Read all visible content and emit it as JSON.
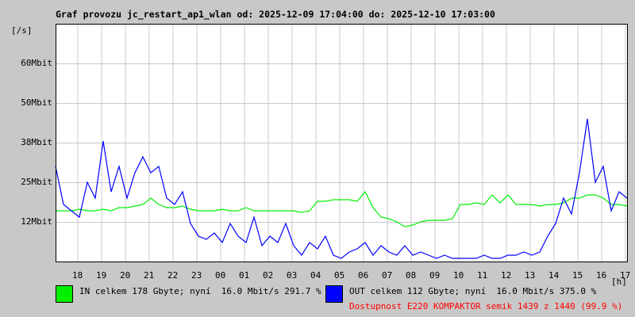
{
  "chart_data": {
    "type": "line",
    "title": "Graf provozu jc_restart_ap1_wlan od: 2025-12-09 17:04:00 do: 2025-12-10 17:03:00",
    "ylabel": "[/s]",
    "xlabel": "[h]",
    "ylim": [
      0,
      75
    ],
    "xlim": [
      0,
      24
    ],
    "y_ticks": [
      {
        "v": 12.5,
        "label": "12Mbit"
      },
      {
        "v": 25,
        "label": "25Mbit"
      },
      {
        "v": 37.5,
        "label": "38Mbit"
      },
      {
        "v": 50,
        "label": "50Mbit"
      },
      {
        "v": 62.5,
        "label": "60Mbit"
      }
    ],
    "x_ticks": [
      "18",
      "19",
      "20",
      "21",
      "22",
      "23",
      "00",
      "01",
      "02",
      "03",
      "04",
      "05",
      "06",
      "07",
      "08",
      "09",
      "10",
      "11",
      "12",
      "13",
      "14",
      "15",
      "16",
      "17"
    ],
    "grid": true,
    "series": [
      {
        "name": "IN",
        "color": "#00f000",
        "values": [
          16,
          16,
          16,
          16.5,
          16,
          16,
          16.5,
          16,
          17,
          17,
          17.5,
          18,
          20,
          18,
          17,
          17,
          17.5,
          16.5,
          16,
          16,
          16,
          16.5,
          16,
          16,
          17,
          16,
          16,
          16,
          16,
          16,
          16,
          15.5,
          16,
          19,
          19,
          19.5,
          19.5,
          19.5,
          19,
          22,
          17,
          14,
          13.5,
          12.5,
          11,
          11.5,
          12.5,
          13,
          13,
          13,
          13.5,
          18,
          18,
          18.5,
          18,
          21,
          18.5,
          21,
          18,
          18,
          18,
          17.5,
          18,
          18,
          18.5,
          20,
          20,
          21,
          21,
          20,
          18,
          18,
          17.5
        ]
      },
      {
        "name": "OUT",
        "color": "#0000ff",
        "values": [
          30,
          18,
          16,
          14,
          25,
          20,
          38,
          22,
          30,
          20,
          28,
          33,
          28,
          30,
          20,
          18,
          22,
          12,
          8,
          7,
          9,
          6,
          12,
          8,
          6,
          14,
          5,
          8,
          6,
          12,
          5,
          2,
          6,
          4,
          8,
          2,
          1,
          3,
          4,
          6,
          2,
          5,
          3,
          2,
          5,
          2,
          3,
          2,
          1,
          2,
          1,
          1,
          1,
          1,
          2,
          1,
          1,
          2,
          2,
          3,
          2,
          3,
          8,
          12,
          20,
          15,
          28,
          45,
          25,
          30,
          16,
          22,
          20
        ]
      }
    ]
  },
  "legend": {
    "in": "IN celkem 178 Gbyte; nyní  16.0 Mbit/s 291.7 %",
    "out": "OUT celkem 112 Gbyte; nyní  16.0 Mbit/s 375.0 %",
    "availability": "Dostupnost E220 KOMPAKTOR semik 1439 z 1440 (99.9 %)"
  },
  "colors": {
    "availability": "#ff0000"
  }
}
